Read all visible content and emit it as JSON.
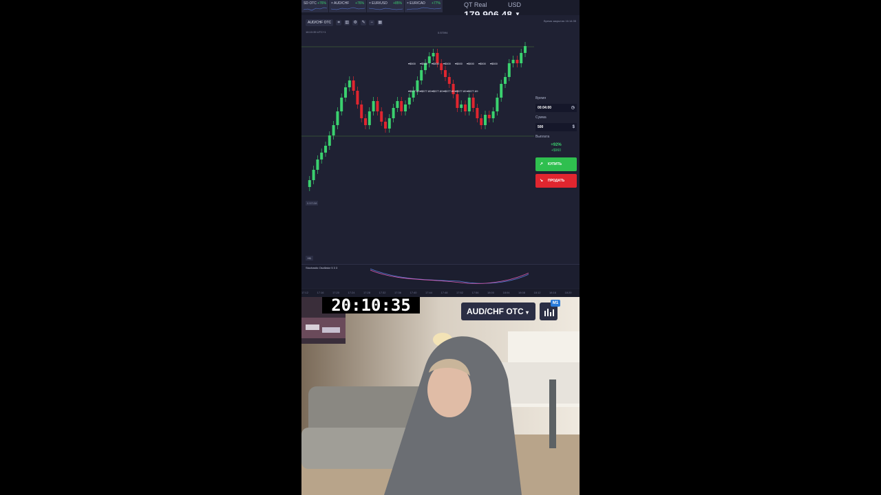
{
  "top_bar": {
    "tabs": [
      {
        "label": "SD OTC",
        "pct": "+76%"
      },
      {
        "label": "× AUD/CHF",
        "pct": "+76%"
      },
      {
        "label": "× EUR/USD",
        "pct": "+85%"
      },
      {
        "label": "× EUR/CAD",
        "pct": "+77%"
      }
    ],
    "account": "QT Real",
    "currency": "USD",
    "balance": "179,906.48"
  },
  "chart": {
    "pair": "AUD/CHF OTC",
    "server_time": "16:10:35 UTC+1",
    "price_tag": "0.57138",
    "high_tag": "0.57094",
    "timeframe": "H1",
    "indicator": "Stochastic Oscillator  5 3 3",
    "trade_labels": [
      "$500",
      "$500",
      "$500",
      "$500",
      "$500",
      "$500",
      "$500",
      "$500",
      "$577.89",
      "$577.89",
      "$577.89",
      "$577.89",
      "$577.89",
      "$577.89"
    ],
    "time_ticks": [
      "17:12",
      "17:16",
      "17:20",
      "17:24",
      "17:28",
      "17:32",
      "17:36",
      "17:40",
      "17:44",
      "17:48",
      "17:52",
      "17:56",
      "18:00",
      "18:04",
      "18:08",
      "18:12",
      "18:16",
      "18:20"
    ]
  },
  "panel": {
    "expiry_note": "Время закрытия 16:14:35",
    "time_label": "Время",
    "time_value": "00:04:00",
    "amount_label": "Сумма",
    "amount_value": "500",
    "payout_label": "Выплата",
    "payout_pct": "+92%",
    "payout_amount": "+$960",
    "buy_label": "КУПИТЬ",
    "sell_label": "ПРОДАТЬ"
  },
  "overlay": {
    "clock": "20:10:35",
    "pair": "AUD/CHF OTC",
    "badge": "M1"
  },
  "colors": {
    "up": "#3bd16f",
    "down": "#e0262f",
    "bg": "#1f2133"
  }
}
